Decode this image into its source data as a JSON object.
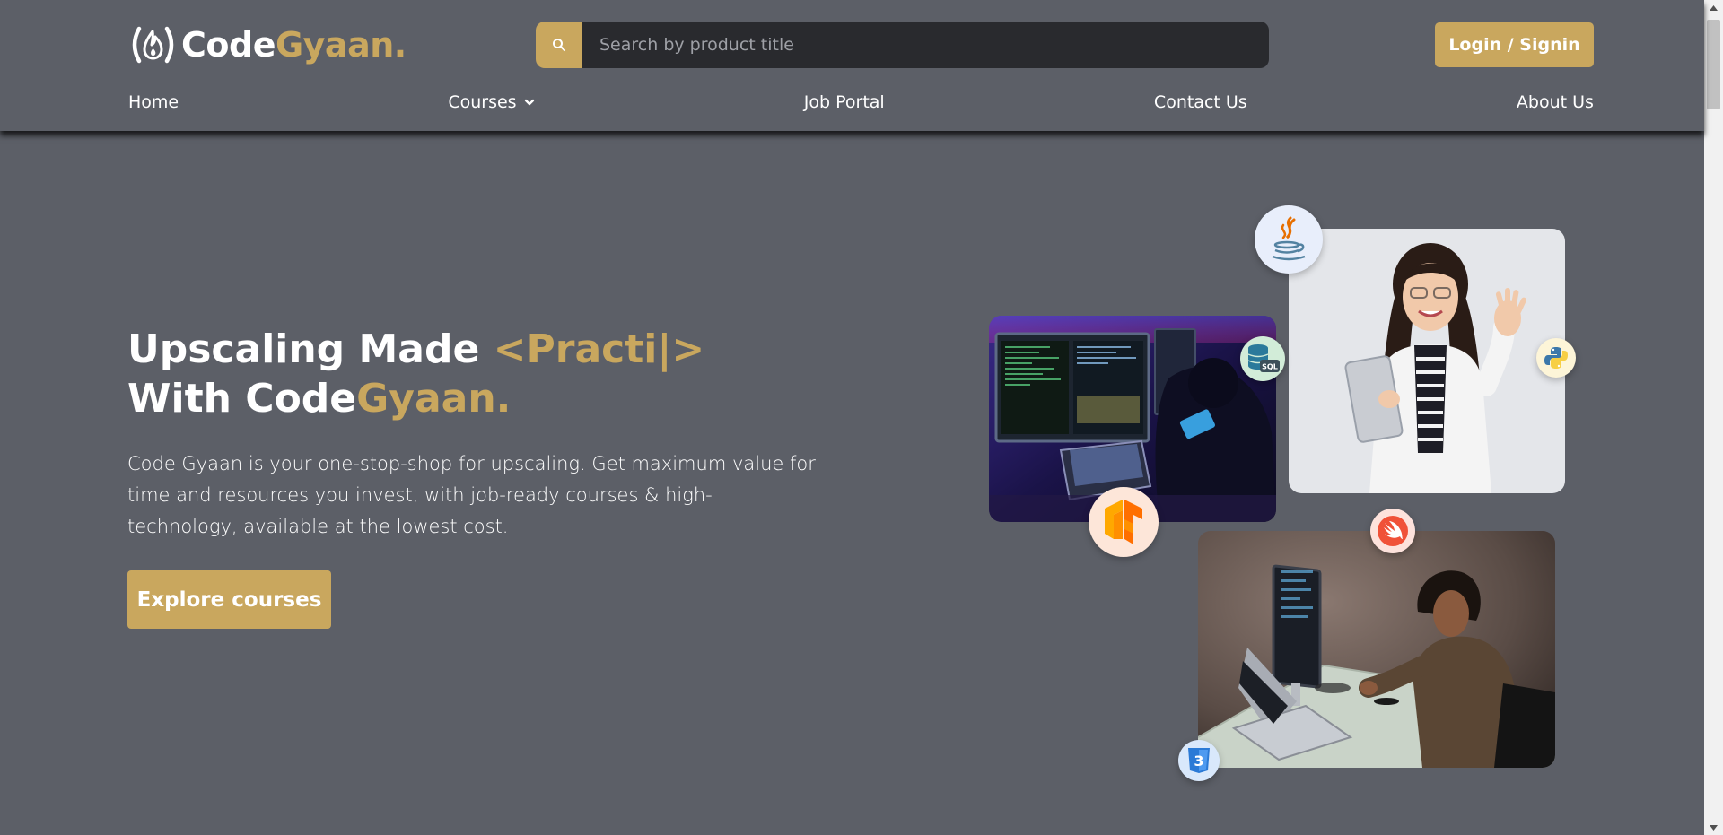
{
  "brand": {
    "name_part1": "Code",
    "name_part2": "Gyaan."
  },
  "search": {
    "placeholder": "Search by product title",
    "value": ""
  },
  "header": {
    "login_label": "Login / Signin"
  },
  "nav": {
    "items": [
      {
        "label": "Home"
      },
      {
        "label": "Courses",
        "has_dropdown": true
      },
      {
        "label": "Job Portal"
      },
      {
        "label": "Contact Us"
      },
      {
        "label": "About Us"
      }
    ]
  },
  "hero": {
    "title_line1": "Upscaling Made ",
    "typed_word": "<Practi|>",
    "title_line2_part1": "With Code",
    "title_line2_part2": "Gyaan.",
    "description": "Code Gyaan is your one-stop-shop for upscaling. Get maximum value for time and resources you invest, with job-ready courses & high-technology, available at the lowest cost.",
    "cta_label": "Explore courses"
  },
  "collage": {
    "badges": [
      {
        "name": "java-icon"
      },
      {
        "name": "sql-database-icon",
        "label": "SQL"
      },
      {
        "name": "python-icon"
      },
      {
        "name": "tensorflow-icon"
      },
      {
        "name": "swift-icon"
      },
      {
        "name": "css3-icon",
        "label": "3"
      }
    ]
  },
  "colors": {
    "background": "#5c5f67",
    "accent": "#c9a75e",
    "search_field": "#292a2e",
    "text": "#ffffff"
  }
}
